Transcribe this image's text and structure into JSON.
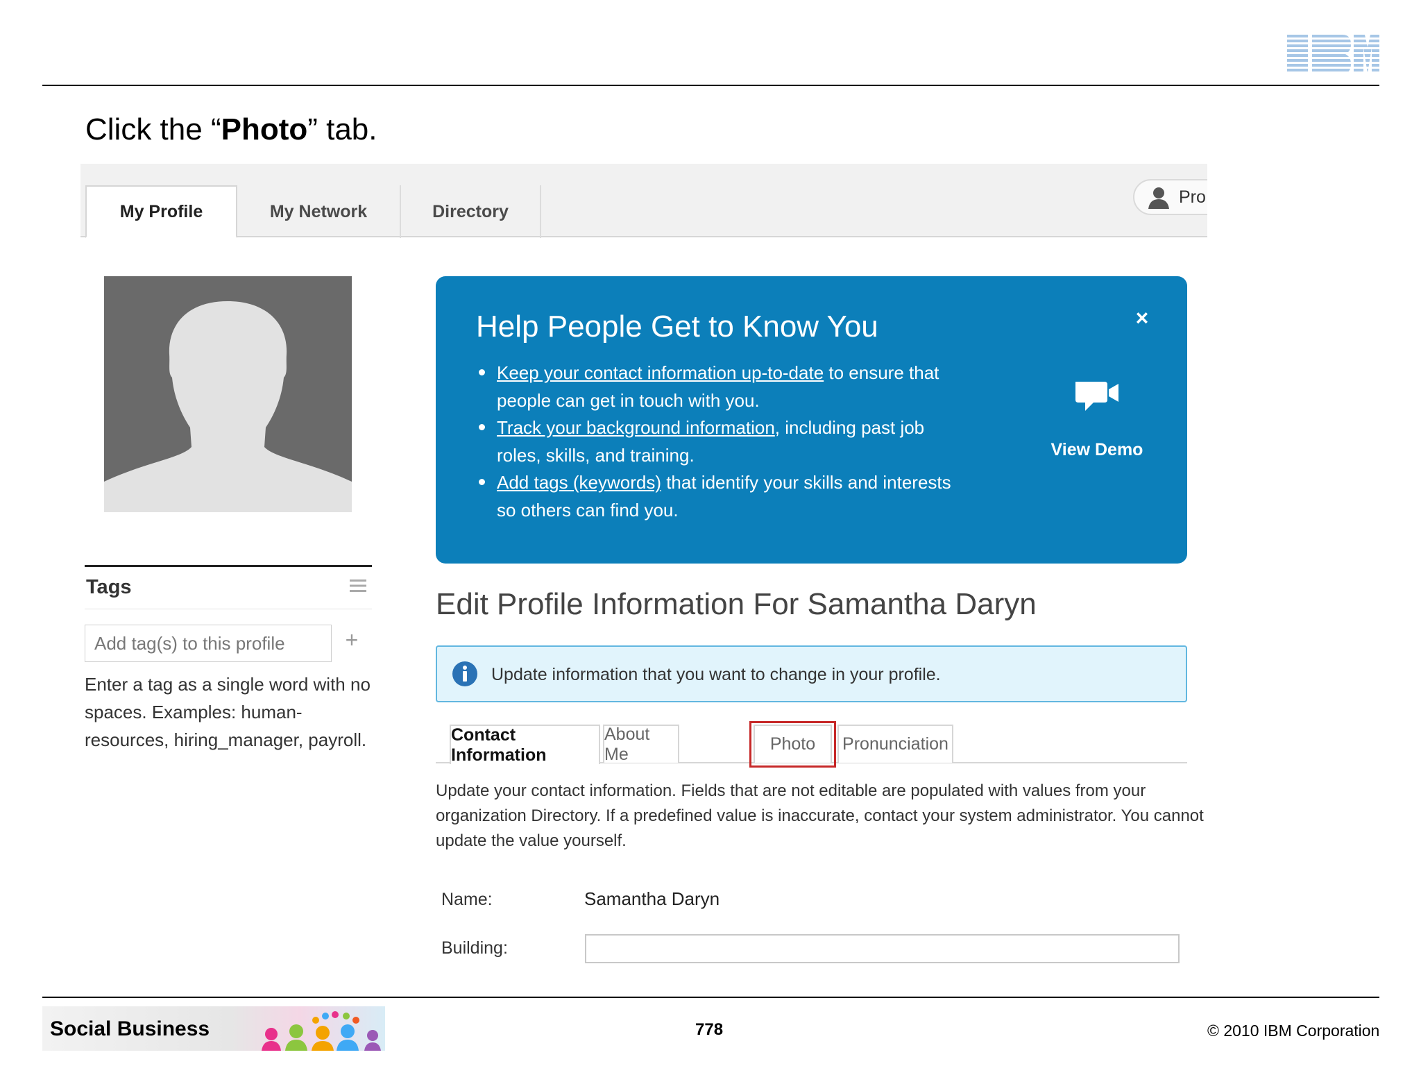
{
  "slide": {
    "logo_text": "IBM",
    "instruction_prefix": "Click the “",
    "instruction_bold": "Photo",
    "instruction_suffix": "” tab.",
    "footer_banner": "Social Business",
    "page_number": "778",
    "copyright": "© 2010 IBM Corporation"
  },
  "nav": {
    "tabs": [
      {
        "label": "My Profile",
        "active": true
      },
      {
        "label": "My Network",
        "active": false
      },
      {
        "label": "Directory",
        "active": false
      }
    ],
    "profile_button": "Pro"
  },
  "tags": {
    "title": "Tags",
    "input_placeholder": "Add tag(s) to this profile",
    "add_symbol": "+",
    "help": "Enter a tag as a single word with no spaces. Examples: human-resources, hiring_manager, payroll."
  },
  "help_box": {
    "title": "Help People Get to Know You",
    "close_symbol": "×",
    "items": [
      {
        "link": "Keep your contact information up-to-date",
        "rest": " to ensure that people can get in touch with you."
      },
      {
        "link": "Track your background information",
        "rest": ", including past job roles, skills, and training."
      },
      {
        "link": "Add tags (keywords)",
        "rest": " that identify your skills and interests so others can find you."
      }
    ],
    "demo_label": "View Demo"
  },
  "edit": {
    "heading": "Edit Profile Information For Samantha Daryn",
    "info_message": "Update information that you want to change in your profile.",
    "tabs": [
      {
        "label": "Contact Information",
        "active": true
      },
      {
        "label": "About Me",
        "active": false
      },
      {
        "label": "Photo",
        "active": false,
        "highlighted": true
      },
      {
        "label": "Pronunciation",
        "active": false
      }
    ],
    "description": "Update your contact information. Fields that are not editable are populated with values from your organization Directory. If a predefined value is inaccurate, contact your system administrator. You cannot update the value yourself.",
    "fields": {
      "name_label": "Name:",
      "name_value": "Samantha Daryn",
      "building_label": "Building:",
      "building_value": ""
    }
  },
  "colors": {
    "help_box_bg": "#0c7fba",
    "info_box_bg": "#e1f4fc",
    "info_box_border": "#62b7e0",
    "highlight_border": "#c62828",
    "ibm_blue": "#1f70c1"
  },
  "icons": {
    "help_close": "close-icon",
    "demo": "video-camera-icon",
    "info": "info-icon",
    "tags_menu": "hamburger-menu-icon",
    "profile": "person-icon"
  }
}
